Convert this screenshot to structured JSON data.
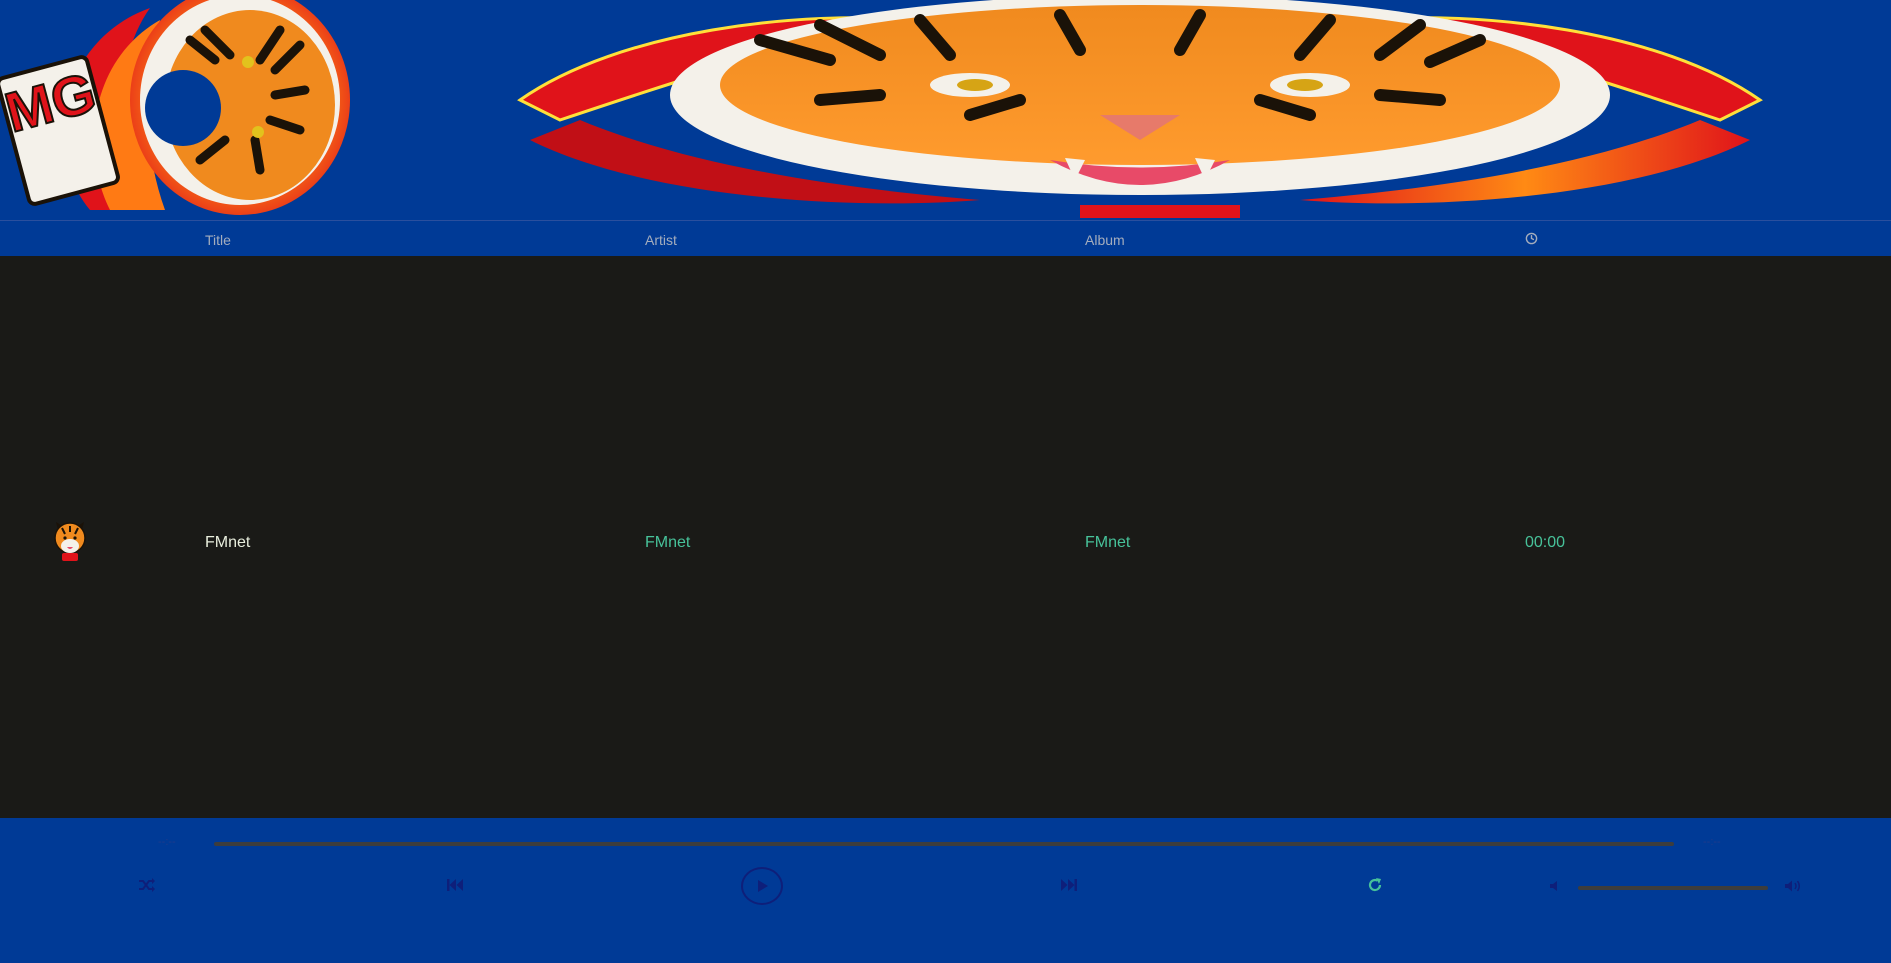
{
  "header": {
    "logo_text": "MG"
  },
  "columns": {
    "title": "Title",
    "artist": "Artist",
    "album": "Album",
    "duration_icon": "clock-icon"
  },
  "tracks": [
    {
      "title": "FMnet",
      "artist": "FMnet",
      "album": "FMnet",
      "duration": "00:00",
      "thumb_icon": "tiger-thumbnail"
    }
  ],
  "player": {
    "elapsed": "--:--",
    "remaining": "--:--",
    "progress": 0,
    "volume": 1.0,
    "icons": {
      "shuffle": "shuffle-icon",
      "previous": "skip-back-icon",
      "play": "play-icon",
      "next": "skip-forward-icon",
      "repeat": "repeat-icon",
      "volume_low": "volume-low-icon",
      "volume_high": "volume-high-icon"
    }
  },
  "colors": {
    "brand_blue": "#003a96",
    "list_bg": "#1a1a17",
    "accent_green": "#47c29a",
    "control_dark_blue": "#0e1f7a",
    "repeat_active": "#47c29a"
  }
}
